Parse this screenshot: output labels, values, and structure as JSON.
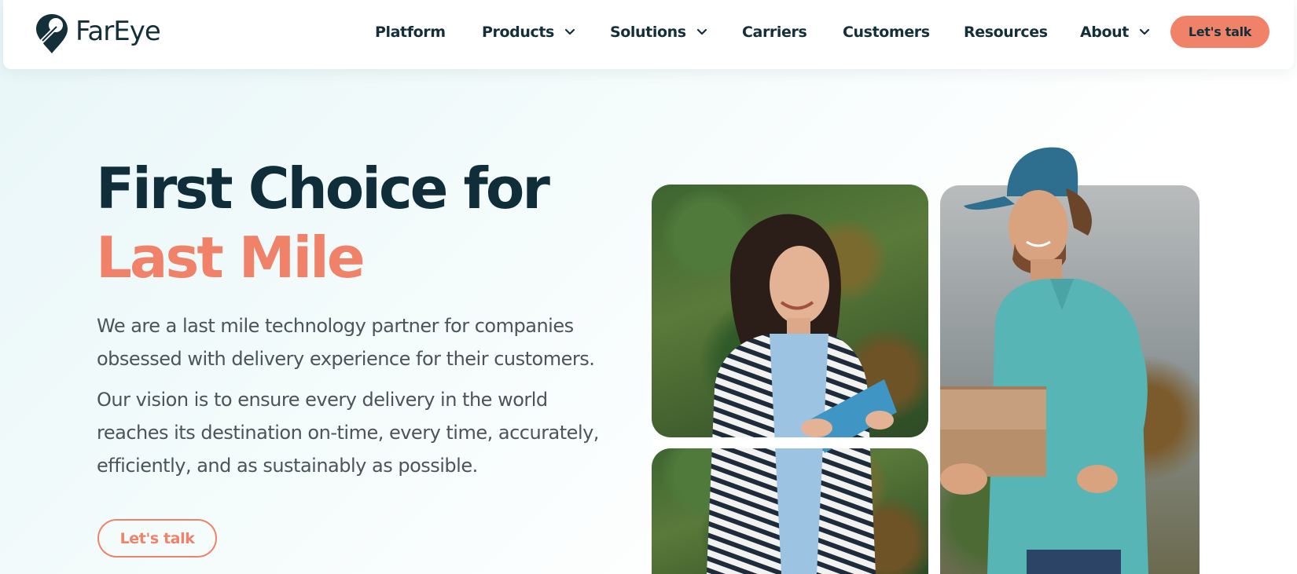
{
  "brand": {
    "name": "FarEye"
  },
  "nav": {
    "items": [
      {
        "label": "Platform",
        "dropdown": false
      },
      {
        "label": "Products",
        "dropdown": true
      },
      {
        "label": "Solutions",
        "dropdown": true
      },
      {
        "label": "Carriers",
        "dropdown": false
      },
      {
        "label": "Customers",
        "dropdown": false
      },
      {
        "label": "Resources",
        "dropdown": false
      },
      {
        "label": "About",
        "dropdown": true
      }
    ],
    "cta_label": "Let's talk"
  },
  "hero": {
    "title_line1": "First Choice for",
    "title_line2": "Last Mile",
    "paragraph1": "We are a last mile technology partner for companies obsessed with delivery experience for their customers.",
    "paragraph2": "Our vision is to ensure every delivery in the world reaches its destination on-time, every time, accurately, efficiently, and as sustainably as possible.",
    "cta_label": "Let's talk"
  },
  "colors": {
    "brand_dark": "#13303a",
    "accent": "#ef8268",
    "body_text": "#4a545a",
    "background": "#f3fbfb"
  },
  "icons": {
    "logo": "map-pin-logo-icon",
    "dropdown": "chevron-down-icon"
  }
}
